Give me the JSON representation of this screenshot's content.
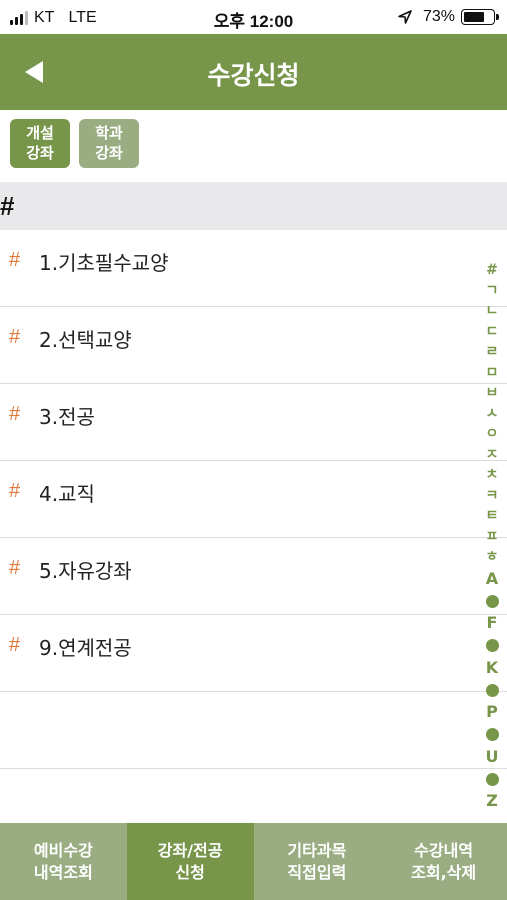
{
  "status_bar": {
    "carrier": "KT",
    "network": "LTE",
    "time": "오후 12:00",
    "battery_percent": "73%",
    "battery_level": 0.73
  },
  "header": {
    "title": "수강신청",
    "back_icon": "back-arrow-icon"
  },
  "filters": [
    {
      "line1": "개설",
      "line2": "강좌",
      "active": true
    },
    {
      "line1": "학과",
      "line2": "강좌",
      "active": false
    }
  ],
  "section": {
    "title": "#"
  },
  "list": {
    "items": [
      {
        "marker": "#",
        "label": "1.기초필수교양"
      },
      {
        "marker": "#",
        "label": "2.선택교양"
      },
      {
        "marker": "#",
        "label": "3.전공"
      },
      {
        "marker": "#",
        "label": "4.교직"
      },
      {
        "marker": "#",
        "label": "5.자유강좌"
      },
      {
        "marker": "#",
        "label": "9.연계전공"
      }
    ]
  },
  "index_bar": {
    "hangul": [
      "#",
      "ㄱ",
      "ㄴ",
      "ㄷ",
      "ㄹ",
      "ㅁ",
      "ㅂ",
      "ㅅ",
      "ㅇ",
      "ㅈ",
      "ㅊ",
      "ㅋ",
      "ㅌ",
      "ㅍ",
      "ㅎ"
    ],
    "latin": [
      "A",
      "F",
      "K",
      "P",
      "U",
      "Z"
    ]
  },
  "tabs": [
    {
      "line1": "예비수강",
      "line2": "내역조회",
      "active": false
    },
    {
      "line1": "강좌/전공",
      "line2": "신청",
      "active": true
    },
    {
      "line1": "기타과목",
      "line2": "직접입력",
      "active": false
    },
    {
      "line1": "수강내역",
      "line2": "조회,삭제",
      "active": false
    }
  ],
  "colors": {
    "primary": "#78964a",
    "secondary": "#9aad82",
    "accent_marker": "#e07a3c",
    "section_bg": "#e9e9ec"
  }
}
